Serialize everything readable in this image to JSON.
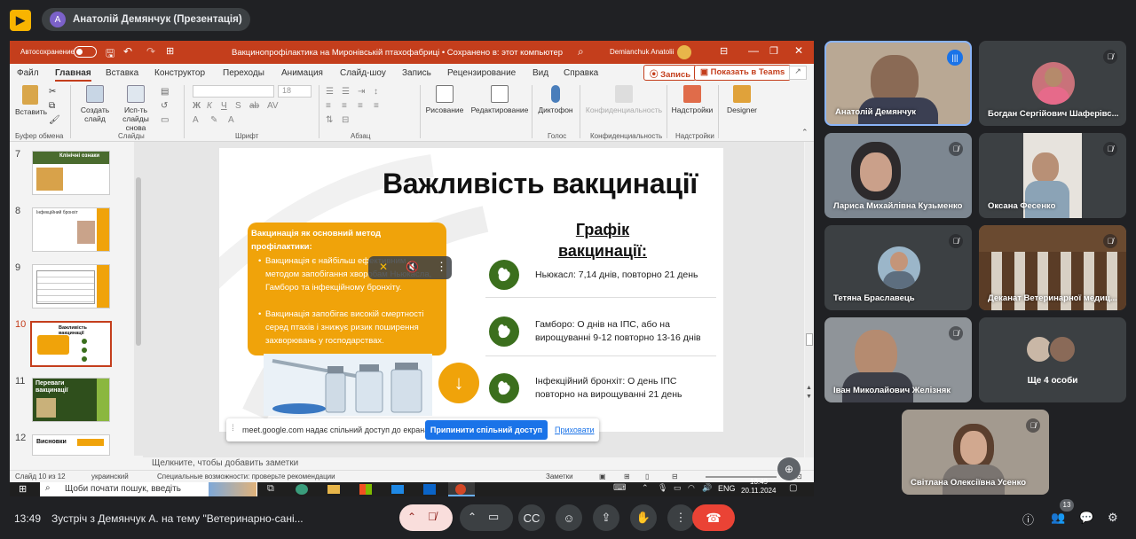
{
  "meet": {
    "logo_icon": "presentation-icon",
    "presenter_avatar": "А",
    "presenter_label": "Анатолій Демянчук (Презентація)",
    "meeting_time": "13:49",
    "meeting_title": "Зустріч з Демянчук А. на тему \"Ветеринарно-сані...",
    "participants_count": "13"
  },
  "ppt": {
    "autosave_label": "Автосохранение",
    "doc_title": "Вакцинопрофілактика на Миронівській птахофабриці • Сохранено в: этот компьютер",
    "user_name": "Demianchuk Anatolii",
    "menu": [
      "Файл",
      "Главная",
      "Вставка",
      "Конструктор",
      "Переходы",
      "Анимация",
      "Слайд-шоу",
      "Запись",
      "Рецензирование",
      "Вид",
      "Справка"
    ],
    "record_btn": "Запись",
    "teams_btn": "Показать в Teams",
    "ribbon": {
      "paste": "Вставить",
      "create_slide": "Создать слайд",
      "reuse": "Исп-ть слайды снова",
      "drawing": "Рисование",
      "editing": "Редактирование",
      "dictation": "Диктофон",
      "privacy": "Конфиденциальность",
      "addins": "Надстройки",
      "designer": "Designer",
      "font_size": "18",
      "groups": [
        "Буфер обмена",
        "Слайды",
        "Шрифт",
        "Абзац",
        "Голос",
        "Конфиденциальность",
        "Надстройки"
      ]
    },
    "thumb_numbers": [
      "7",
      "8",
      "9",
      "10",
      "11",
      "12"
    ],
    "thumb_titles": [
      "Клінічні ознаки",
      "Інфекційний бронхіт",
      "",
      "Важливість вакцинації",
      "Переваги вакцинації",
      "Висновки"
    ],
    "notes_placeholder": "Щелкните, чтобы добавить заметки",
    "status": {
      "slide_of": "Слайд 10 из 12",
      "language": "украинский",
      "accessibility": "Специальные возможности: проверьте рекомендации",
      "notes": "Заметки"
    }
  },
  "slide": {
    "title": "Важливість вакцинації",
    "box_heading": "Вакцинація як основний метод профілактики:",
    "bullets": [
      "Вакцинація є найбільш ефективним методом запобігання хворобам Ньюкасла, Гамборо та інфекційному бронхіту.",
      "Вакцинація запобігає високій смертності серед птахів і знижує ризик поширення захворювань у господарствах."
    ],
    "schedule_title": "Графік вакцинації:",
    "schedule": [
      "Ньюкасл: 7,14 днів, повторно 21 день",
      "Гамборо: О днів на ІПС, або на вирощуванні 9-12 повторно 13-16 днів",
      "Інфекційний бронхіт: О день ІПС повторно на вирощуванні 21 день"
    ],
    "arrow_icon": "down-arrow-icon"
  },
  "share_bar": {
    "text": "meet.google.com надає спільний доступ до екрана.",
    "stop_btn": "Припинити спільний доступ",
    "hide_link": "Приховати"
  },
  "taskbar": {
    "search_placeholder": "Щоби почати пошук, введіть",
    "lang": "ENG",
    "time": "13:49",
    "date": "20.11.2024"
  },
  "participants": [
    {
      "name": "Анатолій Демянчук",
      "state": "speaking",
      "bg": "#b9a894"
    },
    {
      "name": "Богдан Сергійович Шаферівс...",
      "state": "muted",
      "bg": "#3c4043"
    },
    {
      "name": "Лариса Михайлівна Кузьменко",
      "state": "muted",
      "bg": "#7d8791"
    },
    {
      "name": "Оксана Фесенко",
      "state": "muted",
      "bg": "#3c4043"
    },
    {
      "name": "Тетяна Браславець",
      "state": "muted",
      "bg": "#3c4043"
    },
    {
      "name": "Деканат Ветеринарної медиц...",
      "state": "muted",
      "bg": "#8b6b4a"
    },
    {
      "name": "Іван Миколайович Желізняк",
      "state": "muted",
      "bg": "#8f9499"
    },
    {
      "name": "Ще 4 особи",
      "state": "group",
      "bg": "#3c4043"
    },
    {
      "name": "Світлана Олексіївна Усенко",
      "state": "muted",
      "bg": "#a39a8f"
    }
  ]
}
